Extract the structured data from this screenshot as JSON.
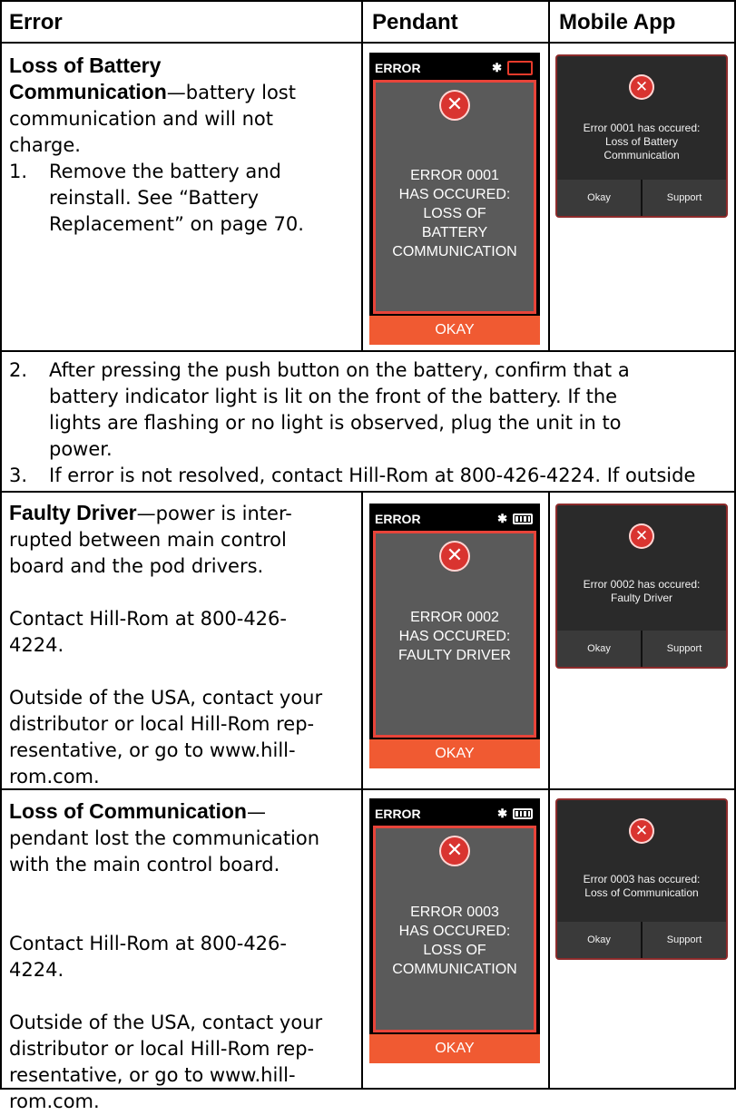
{
  "header": {
    "col_error": "Error",
    "col_pendant": "Pendant",
    "col_app": "Mobile App"
  },
  "row1": {
    "title": "Loss of Battery Communication",
    "title_line1": "Loss of Battery",
    "title_line2": "Communication",
    "desc_part1": "—battery lost",
    "desc_part2": "communication and will not",
    "desc_part3": "charge.",
    "step1_num": "1.",
    "step1_l1": "Remove the battery and",
    "step1_l2": "reinstall. See “Battery",
    "step1_l3": "Replacement” on page 70.",
    "pendant": {
      "header": "ERROR",
      "battery": "empty",
      "line1": "ERROR 0001",
      "line2": "HAS OCCURED:",
      "line3": "LOSS OF",
      "line4": "BATTERY",
      "line5": "COMMUNICATION",
      "button": "OKAY"
    },
    "app": {
      "line1": "Error 0001 has occured:",
      "line2": "Loss of Battery",
      "line3": "Communication",
      "btn_okay": "Okay",
      "btn_support": "Support"
    }
  },
  "row2": {
    "step2_num": "2.",
    "step2_l1": "After pressing the push button on the battery, confirm that a",
    "step2_l2": "battery indicator light is lit on the front of the  battery. If the",
    "step2_l3": "lights are flashing or no light is observed, plug the unit in to",
    "step2_l4": "power.",
    "step3_num": "3.",
    "step3_l1": "If error is not resolved, contact Hill-Rom at 800-426-4224. If outside"
  },
  "row3": {
    "title": "Faulty Driver",
    "desc_l1": "—power is inter-",
    "desc_l2": "rupted between main control",
    "desc_l3": "board and the pod drivers.",
    "contact_l1": "Contact Hill-Rom at 800-426-",
    "contact_l2": "4224.",
    "outside_l1": "Outside of the USA, contact your",
    "outside_l2": "distributor or local Hill-Rom rep-",
    "outside_l3": "resentative, or go to www.hill-",
    "outside_l4": "rom.com.",
    "pendant": {
      "header": "ERROR",
      "battery": "full",
      "line1": "ERROR 0002",
      "line2": "HAS OCCURED:",
      "line3": "FAULTY DRIVER",
      "button": "OKAY"
    },
    "app": {
      "line1": "Error 0002 has occured:",
      "line2": "Faulty Driver",
      "btn_okay": "Okay",
      "btn_support": "Support"
    }
  },
  "row4": {
    "title": "Loss of Communication",
    "desc_l0": "—",
    "desc_l1": "pendant lost the communication",
    "desc_l2": "with the main control board.",
    "contact_l1": "Contact Hill-Rom at 800-426-",
    "contact_l2": "4224.",
    "outside_l1": "Outside of the USA, contact your",
    "outside_l2": "distributor or local Hill-Rom rep-",
    "outside_l3": "resentative, or go to www.hill-",
    "outside_l4": "rom.com.",
    "pendant": {
      "header": "ERROR",
      "battery": "full",
      "line1": "ERROR 0003",
      "line2": "HAS OCCURED:",
      "line3": "LOSS OF",
      "line4": "COMMUNICATION",
      "button": "OKAY"
    },
    "app": {
      "line1": "Error 0003 has occured:",
      "line2": "Loss of Communication",
      "btn_okay": "Okay",
      "btn_support": "Support"
    }
  },
  "icons": {
    "error": "x-circle-icon",
    "bluetooth": "bluetooth-icon",
    "battery": "battery-icon"
  }
}
